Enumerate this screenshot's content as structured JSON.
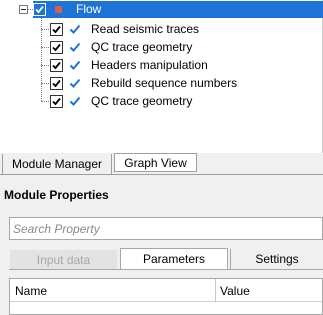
{
  "tree": {
    "root": {
      "label": "Flow",
      "checked": true,
      "selected": true
    },
    "items": [
      {
        "label": "Read seismic traces",
        "checked": true
      },
      {
        "label": "QC trace geometry",
        "checked": true
      },
      {
        "label": "Headers manipulation",
        "checked": true
      },
      {
        "label": "Rebuild sequence numbers",
        "checked": true
      },
      {
        "label": "QC trace geometry",
        "checked": true
      }
    ],
    "colors": {
      "selection": "#1e73d6",
      "flow_square": "#d2614d",
      "tick": "#1e73d6"
    }
  },
  "bottom_tabs": [
    {
      "label": "Module Manager",
      "active": false
    },
    {
      "label": "Graph View",
      "active": true
    }
  ],
  "module_properties": {
    "title": "Module Properties",
    "search": {
      "placeholder": "Search Property",
      "value": ""
    },
    "tabs": [
      {
        "label": "Input data",
        "enabled": false
      },
      {
        "label": "Parameters",
        "active": true
      },
      {
        "label": "Settings",
        "active": false
      }
    ],
    "grid": {
      "columns": [
        "Name",
        "Value"
      ]
    }
  }
}
